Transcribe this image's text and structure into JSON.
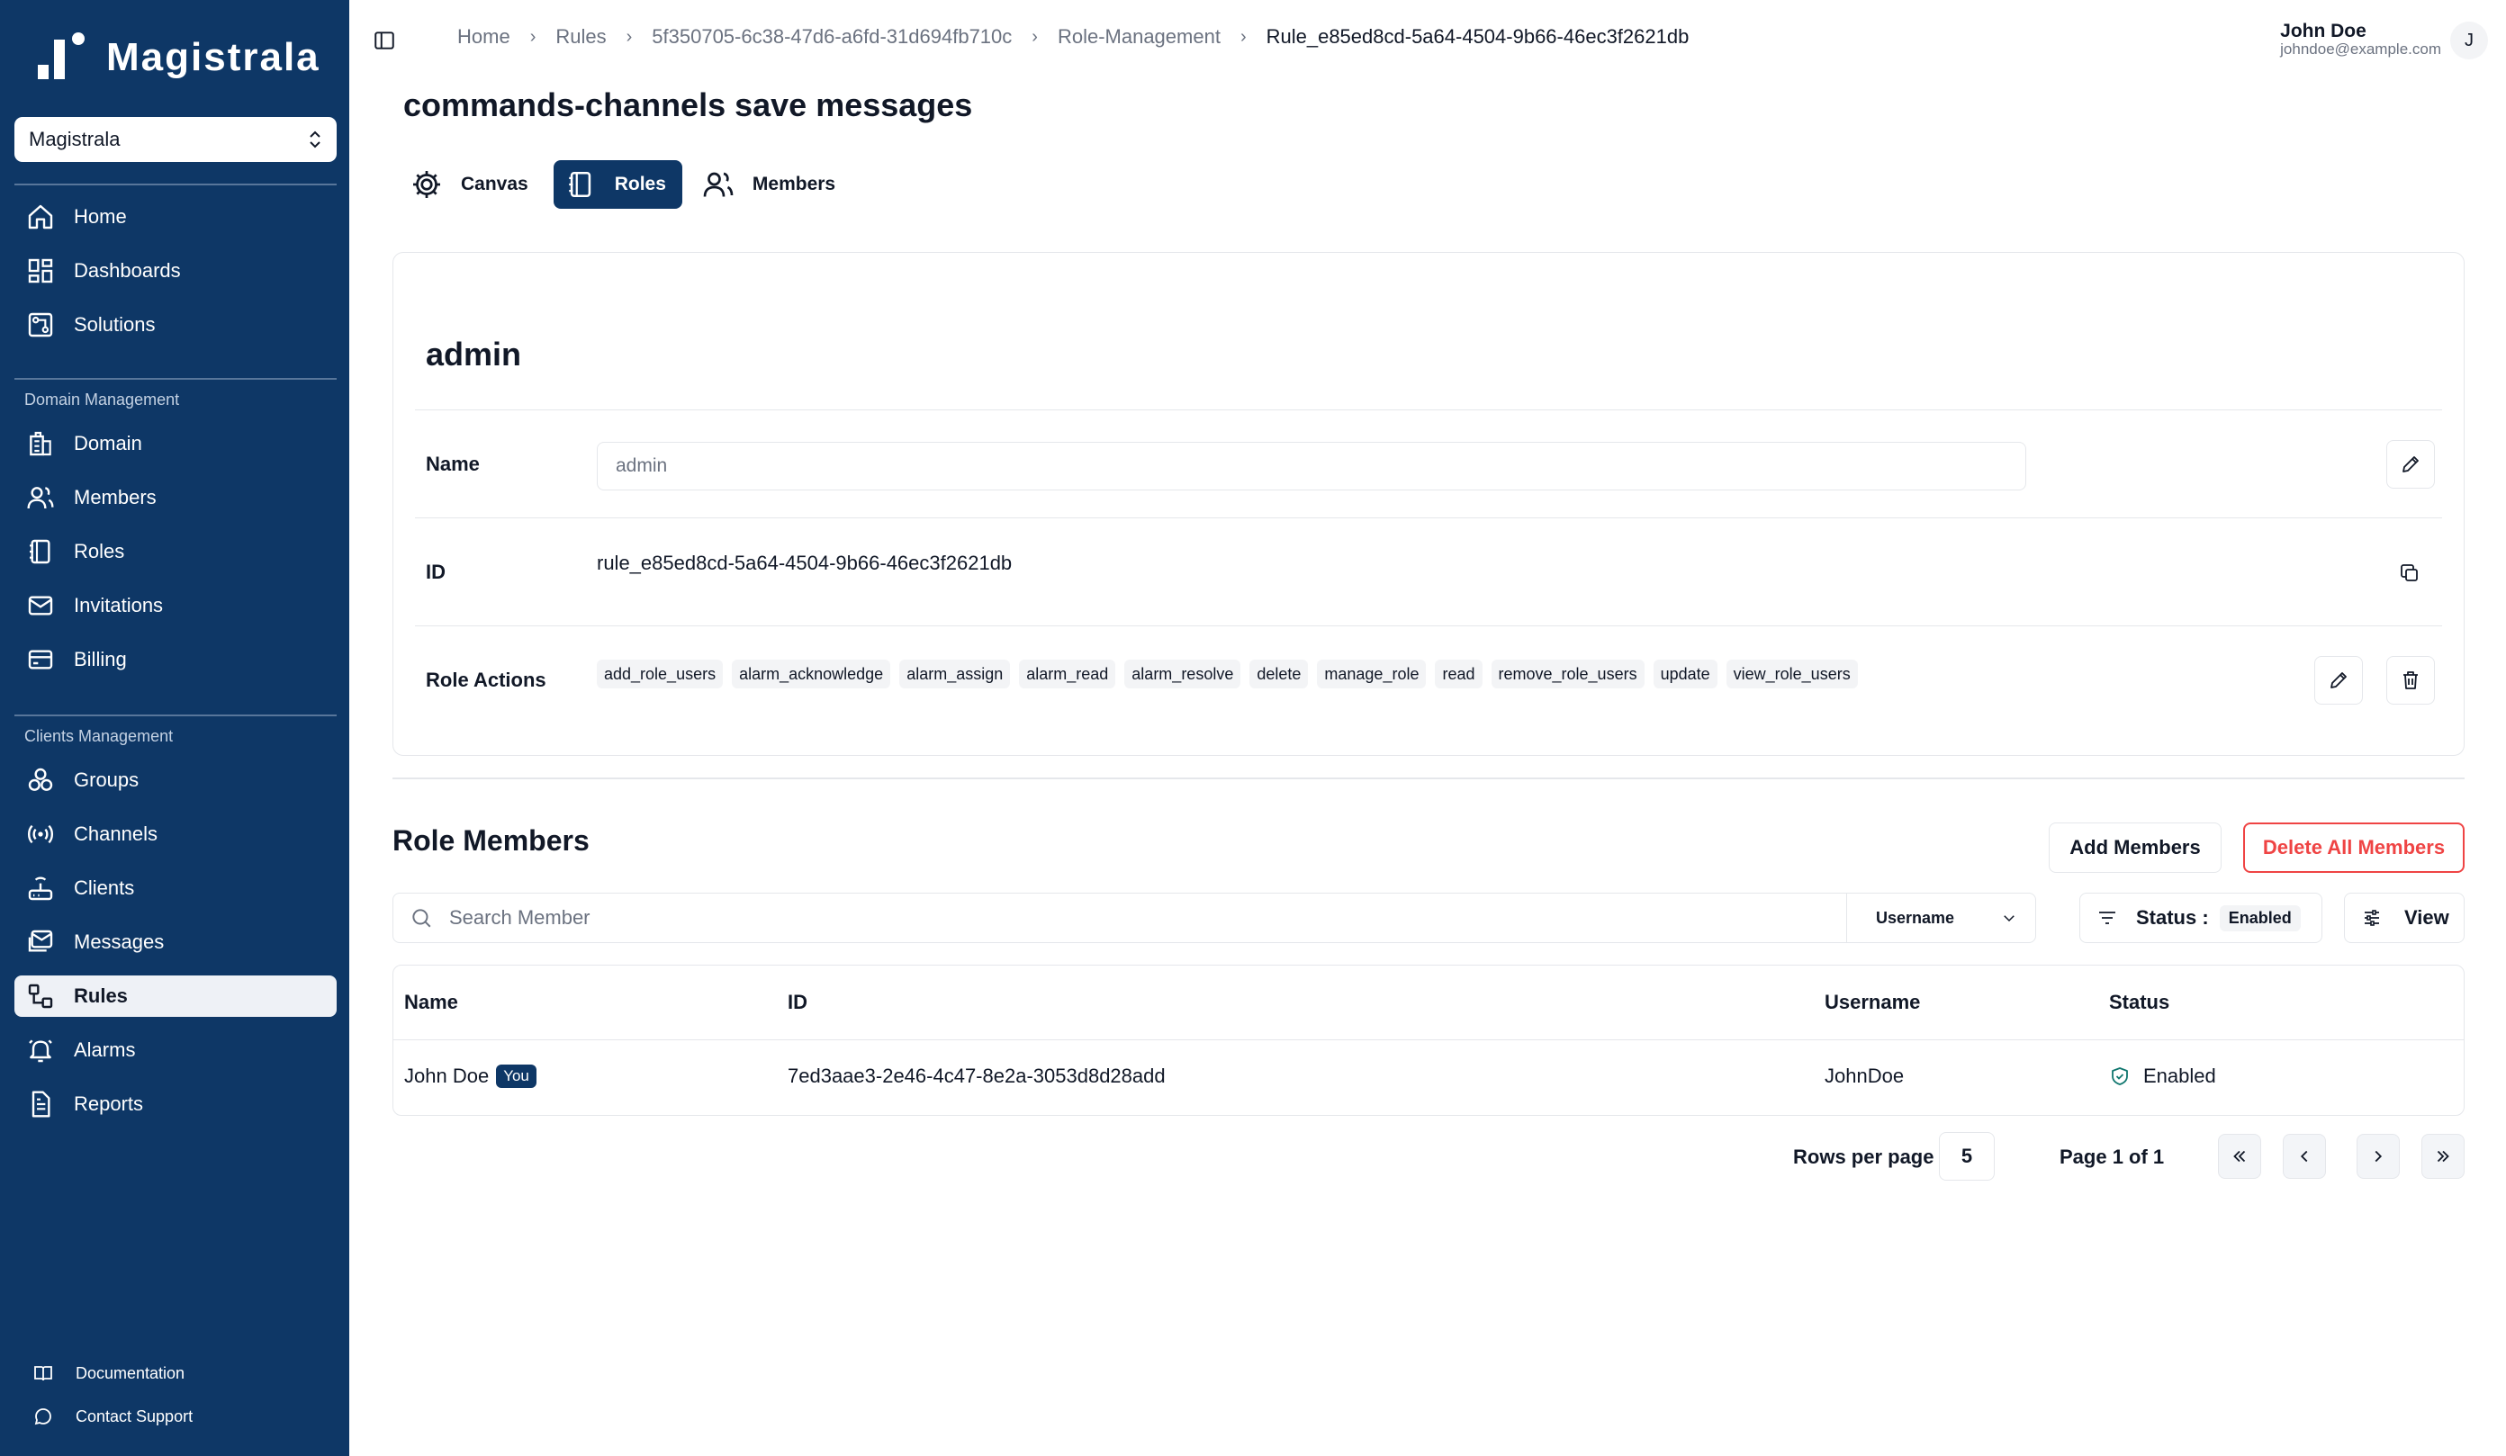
{
  "app": {
    "name": "Magistrala"
  },
  "sidebar": {
    "domain_select": "Magistrala",
    "main_items": [
      {
        "label": "Home",
        "icon": "home-icon"
      },
      {
        "label": "Dashboards",
        "icon": "dashboard-icon"
      },
      {
        "label": "Solutions",
        "icon": "solutions-icon"
      }
    ],
    "domain_section_label": "Domain Management",
    "domain_items": [
      {
        "label": "Domain",
        "icon": "building-icon"
      },
      {
        "label": "Members",
        "icon": "users-icon"
      },
      {
        "label": "Roles",
        "icon": "notebook-icon"
      },
      {
        "label": "Invitations",
        "icon": "mail-icon"
      },
      {
        "label": "Billing",
        "icon": "wallet-icon"
      }
    ],
    "clients_section_label": "Clients Management",
    "clients_items": [
      {
        "label": "Groups",
        "icon": "groups-icon"
      },
      {
        "label": "Channels",
        "icon": "broadcast-icon"
      },
      {
        "label": "Clients",
        "icon": "router-icon"
      },
      {
        "label": "Messages",
        "icon": "messages-icon"
      },
      {
        "label": "Rules",
        "icon": "rules-icon",
        "active": true
      },
      {
        "label": "Alarms",
        "icon": "bell-icon"
      },
      {
        "label": "Reports",
        "icon": "report-icon"
      }
    ],
    "footer": {
      "documentation": "Documentation",
      "support": "Contact Support"
    }
  },
  "header": {
    "breadcrumb": [
      "Home",
      "Rules",
      "5f350705-6c38-47d6-a6fd-31d694fb710c",
      "Role-Management",
      "Rule_e85ed8cd-5a64-4504-9b66-46ec3f2621db"
    ],
    "user": {
      "name": "John Doe",
      "email": "johndoe@example.com",
      "initial": "J"
    }
  },
  "page": {
    "title": "commands-channels save messages",
    "tabs": [
      {
        "label": "Canvas",
        "icon": "gear-icon"
      },
      {
        "label": "Roles",
        "icon": "notebook-icon",
        "active": true
      },
      {
        "label": "Members",
        "icon": "users-icon"
      }
    ]
  },
  "role": {
    "title": "admin",
    "name_label": "Name",
    "name_value": "admin",
    "id_label": "ID",
    "id_value": "rule_e85ed8cd-5a64-4504-9b66-46ec3f2621db",
    "actions_label": "Role Actions",
    "actions": [
      "add_role_users",
      "alarm_acknowledge",
      "alarm_assign",
      "alarm_read",
      "alarm_resolve",
      "delete",
      "manage_role",
      "read",
      "remove_role_users",
      "update",
      "view_role_users"
    ]
  },
  "members": {
    "title": "Role Members",
    "add_button": "Add Members",
    "delete_all_button": "Delete All Members",
    "search_placeholder": "Search Member",
    "search_field": "Username",
    "status_label": "Status :",
    "status_value": "Enabled",
    "view_button": "View",
    "columns": [
      "Name",
      "ID",
      "Username",
      "Status"
    ],
    "rows": [
      {
        "name": "John Doe",
        "badge": "You",
        "id": "7ed3aae3-2e46-4c47-8e2a-3053d8d28add",
        "username": "JohnDoe",
        "status": "Enabled"
      }
    ],
    "pagination": {
      "rows_per_page_label": "Rows per page",
      "rows_per_page": "5",
      "page_info": "Page 1 of 1"
    }
  },
  "colors": {
    "sidebar_bg": "#0e3766",
    "primary": "#0e3766",
    "danger": "#ef4444",
    "status_ok": "#0f766e"
  }
}
